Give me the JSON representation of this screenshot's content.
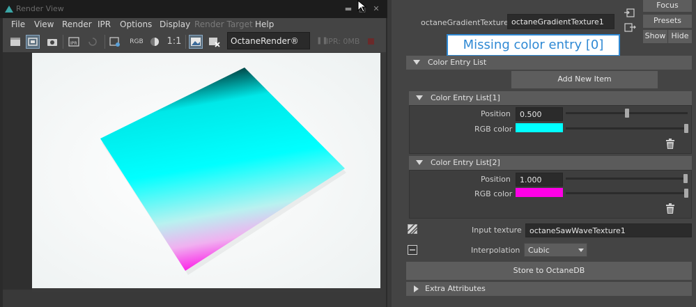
{
  "render_view": {
    "title": "Render View",
    "menu": [
      "File",
      "View",
      "Render",
      "IPR",
      "Options",
      "Display",
      "Render Target",
      "Help"
    ],
    "toolbar": {
      "rgb_label": "RGB",
      "ratio_label": "1:1",
      "renderer": "OctaneRender®",
      "ipr_status": "IPR: 0MB"
    }
  },
  "attribute_editor": {
    "texture_label": "octaneGradientTexture:",
    "texture_name": "octaneGradientTexture1",
    "focus_label": "Focus",
    "presets_label": "Presets",
    "show_label": "Show",
    "hide_label": "Hide",
    "missing_entry": "Missing color entry [0]",
    "color_entry_list": {
      "title": "Color Entry List",
      "add_item": "Add New Item",
      "entries": [
        {
          "title": "Color Entry List[1]",
          "position_label": "Position",
          "position": "0.500",
          "position_fraction": 0.5,
          "color_label": "RGB color",
          "color": "#00ffff"
        },
        {
          "title": "Color Entry List[2]",
          "position_label": "Position",
          "position": "1.000",
          "position_fraction": 1.0,
          "color_label": "RGB color",
          "color": "#ff00e6"
        }
      ]
    },
    "input_texture_label": "Input texture",
    "input_texture": "octaneSawWaveTexture1",
    "interpolation_label": "Interpolation",
    "interpolation": "Cubic",
    "store_button": "Store to OctaneDB",
    "extra_attributes": "Extra Attributes"
  },
  "colors": {
    "accent": "#2f89d4",
    "gradient_top": "#00ffff",
    "gradient_bottom": "#ff00e6"
  }
}
